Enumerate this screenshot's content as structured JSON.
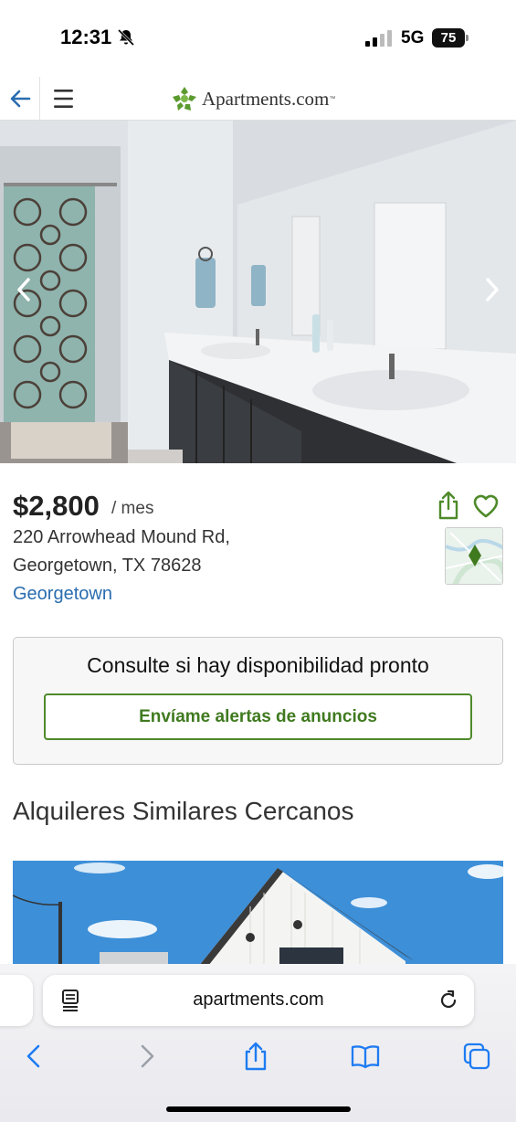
{
  "status_bar": {
    "time": "12:31",
    "network": "5G",
    "battery": "75"
  },
  "app_header": {
    "logo_text": "Apartments.com",
    "logo_tm": "™"
  },
  "listing": {
    "price": "$2,800",
    "period": "/ mes",
    "address_line1": "220 Arrowhead Mound Rd,",
    "address_line2": "Georgetown, TX 78628",
    "neighborhood": "Georgetown"
  },
  "availability": {
    "message": "Consulte si hay disponibilidad pronto",
    "alert_button": "Envíame alertas de anuncios"
  },
  "similar": {
    "heading": "Alquileres Similares Cercanos"
  },
  "browser": {
    "url": "apartments.com"
  },
  "colors": {
    "brand_green": "#4e8a2a",
    "link_blue": "#2a6db0",
    "ios_blue": "#1e7cf2"
  },
  "icons": [
    "back-arrow-icon",
    "hamburger-menu-icon",
    "apartments-logo-icon",
    "chevron-left-icon",
    "chevron-right-icon",
    "share-icon",
    "heart-icon",
    "map-thumbnail",
    "reader-icon",
    "reload-icon",
    "safari-back-icon",
    "safari-forward-icon",
    "safari-share-icon",
    "bookmarks-icon",
    "tabs-icon"
  ]
}
